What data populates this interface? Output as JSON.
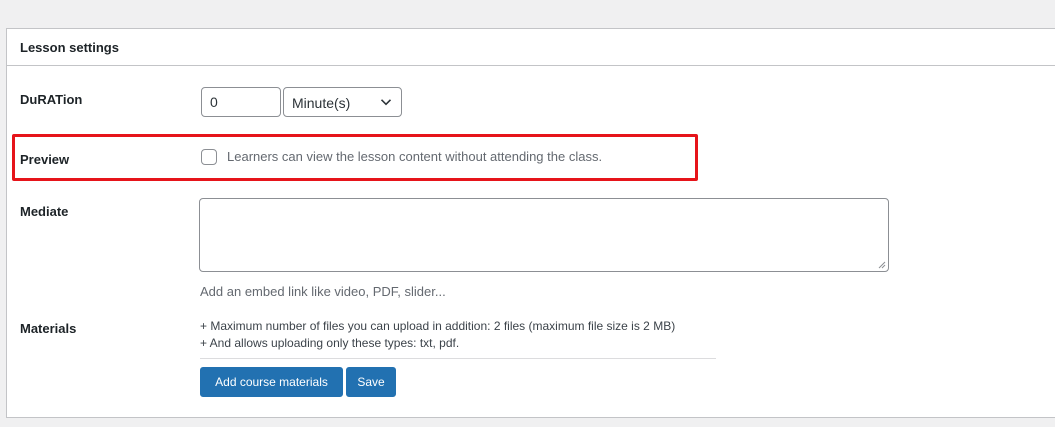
{
  "panel": {
    "title": "Lesson settings"
  },
  "duration": {
    "label": "DuRATion",
    "value": "0",
    "unit_selected": "Minute(s)"
  },
  "preview": {
    "label": "Preview",
    "description": "Learners can view the lesson content without attending the class.",
    "checked": false
  },
  "media": {
    "label": "Mediate",
    "value": "",
    "hint": "Add an embed link like video, PDF, slider..."
  },
  "materials": {
    "label": "Materials",
    "note_max_files": "+ Maximum number of files you can upload in addition: 2 files (maximum file size is 2 MB)",
    "note_types": "+ And allows uploading only these types: txt, pdf.",
    "add_button": "Add course materials",
    "save_button": "Save"
  },
  "colors": {
    "primary_button": "#2271b1",
    "highlight": "#e6141a"
  },
  "icons": {
    "select": "chevron-down-icon",
    "textarea": "resize-grip-icon"
  }
}
